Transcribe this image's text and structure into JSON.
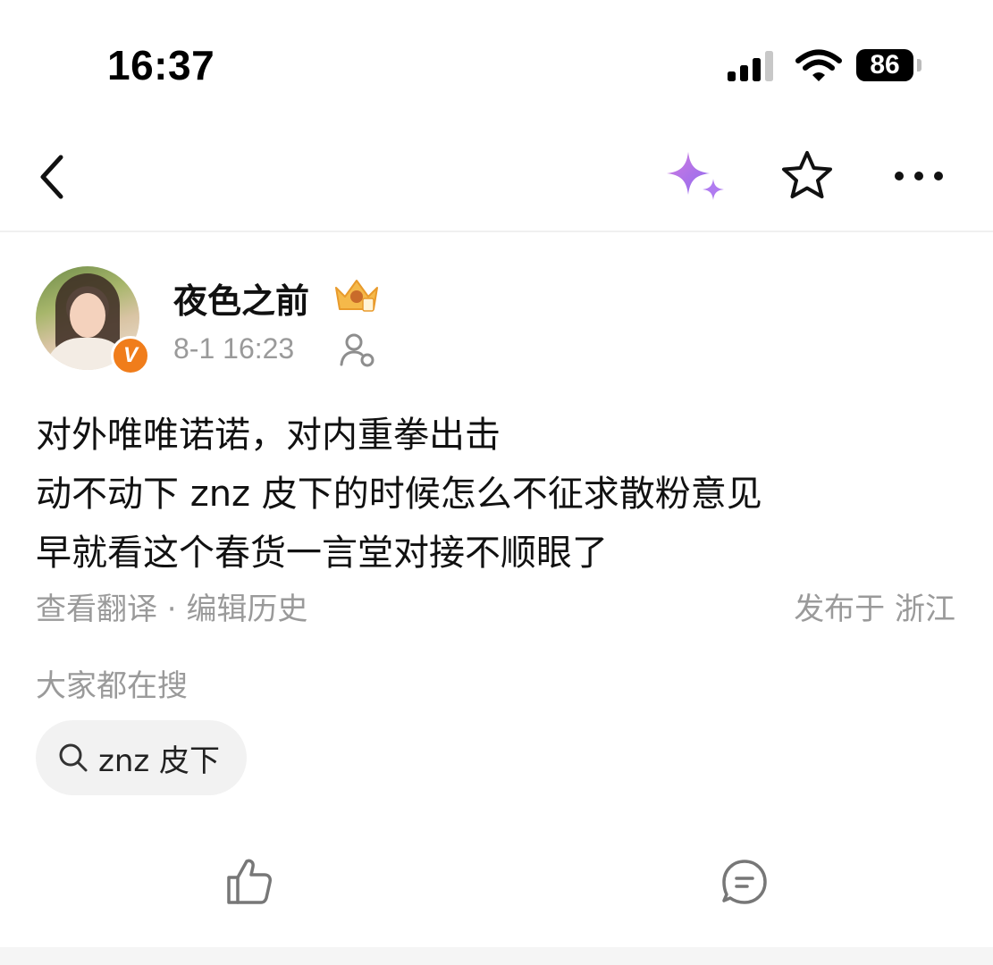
{
  "status_bar": {
    "time": "16:37",
    "battery_level": "86",
    "icons": [
      "signal-icon",
      "wifi-icon",
      "battery-icon"
    ]
  },
  "nav": {
    "icons": [
      "back-icon",
      "ai-sparkle-icon",
      "star-icon",
      "more-icon"
    ]
  },
  "post": {
    "author": {
      "name": "夜色之前",
      "verified_badge": "V",
      "badge_icon": "crown-badge-icon"
    },
    "timestamp": "8-1 16:23",
    "content_lines": [
      "对外唯唯诺诺，对内重拳出击",
      "动不动下 znz 皮下的时候怎么不征求散粉意见",
      "早就看这个春货一言堂对接不顺眼了"
    ],
    "view_translation": "查看翻译",
    "separator": " · ",
    "edit_history": "编辑历史",
    "location": "发布于 浙江"
  },
  "trending": {
    "heading": "大家都在搜",
    "chip_label": "znz 皮下"
  },
  "actions": {
    "icons": [
      "like-icon",
      "comment-icon"
    ]
  },
  "colors": {
    "text_primary": "#111111",
    "text_secondary": "#9a9a9a",
    "verified_orange": "#f07d1b",
    "sparkle_purple": "#a66cf0",
    "chip_bg": "#f2f2f2"
  }
}
